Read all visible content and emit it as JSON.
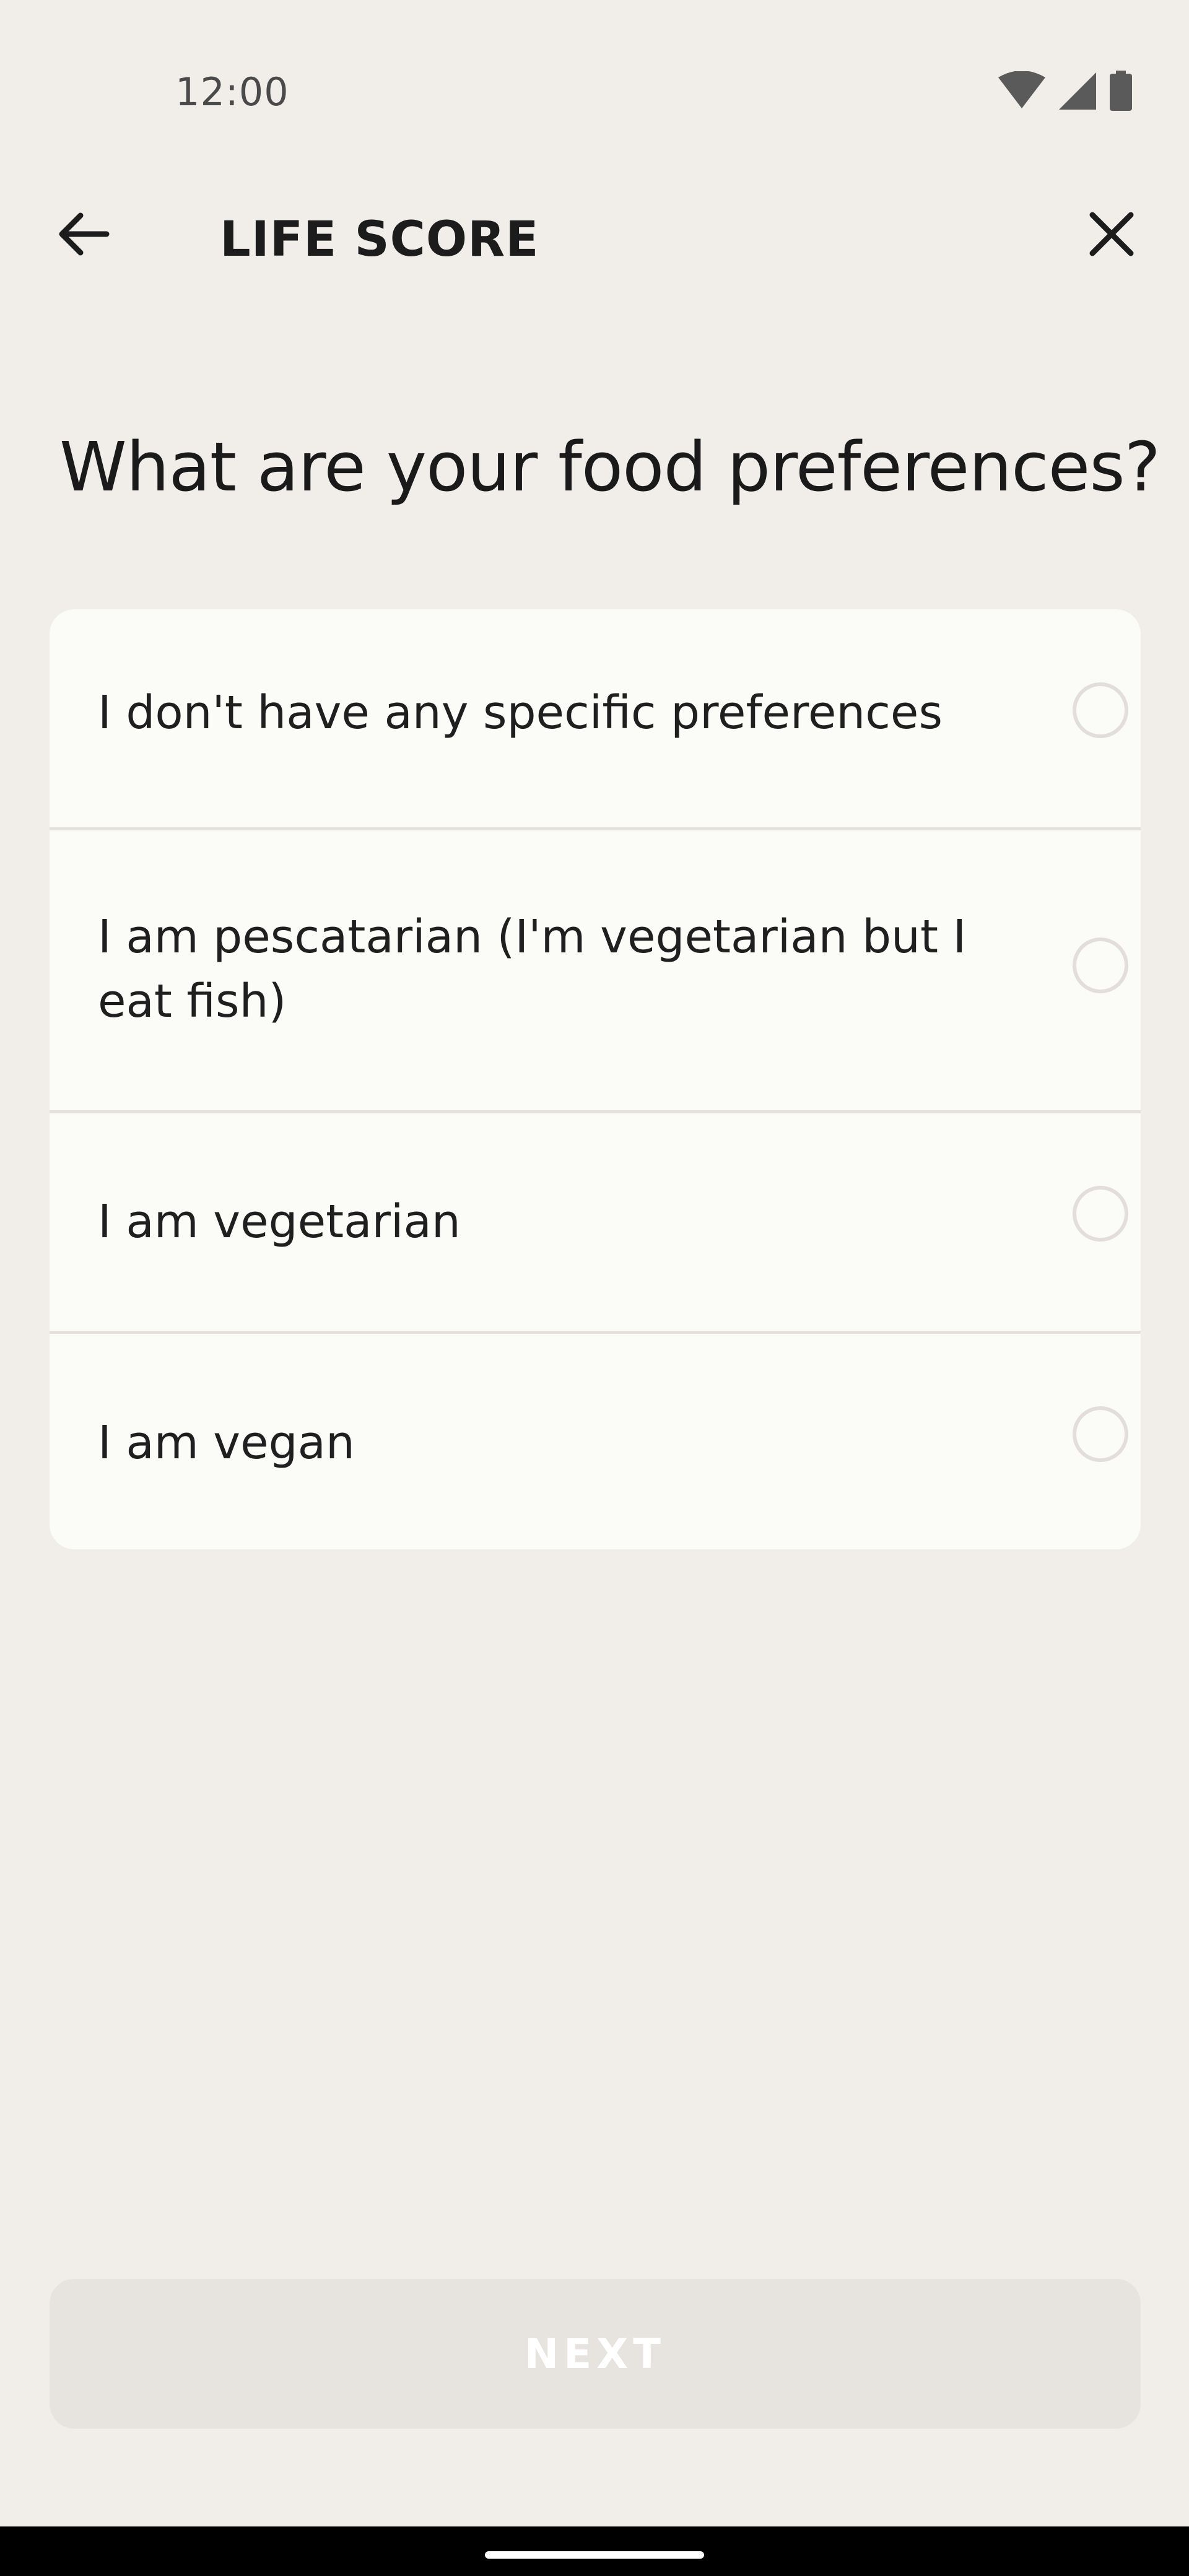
{
  "status_bar": {
    "time": "12:00",
    "icons": [
      "wifi-icon",
      "cellular-signal-icon",
      "battery-icon"
    ]
  },
  "app_bar": {
    "title": "LIFE SCORE",
    "back_icon": "arrow-left-icon",
    "close_icon": "close-icon"
  },
  "question": "What are your food preferences?",
  "options": [
    {
      "label": "I don't have any specific preferences",
      "selected": false
    },
    {
      "label": "I am pescatarian (I'm vegetarian but I eat fish)",
      "selected": false
    },
    {
      "label": "I am vegetarian",
      "selected": false
    },
    {
      "label": "I am vegan",
      "selected": false
    }
  ],
  "next_button": {
    "label": "NEXT",
    "enabled": false
  },
  "colors": {
    "background": "#f1eeea",
    "card": "#fbfbf8",
    "divider": "#e4e1dc",
    "radio_border": "#e3dedb",
    "button_disabled": "#e7e3de",
    "text": "#1a1a1a"
  }
}
